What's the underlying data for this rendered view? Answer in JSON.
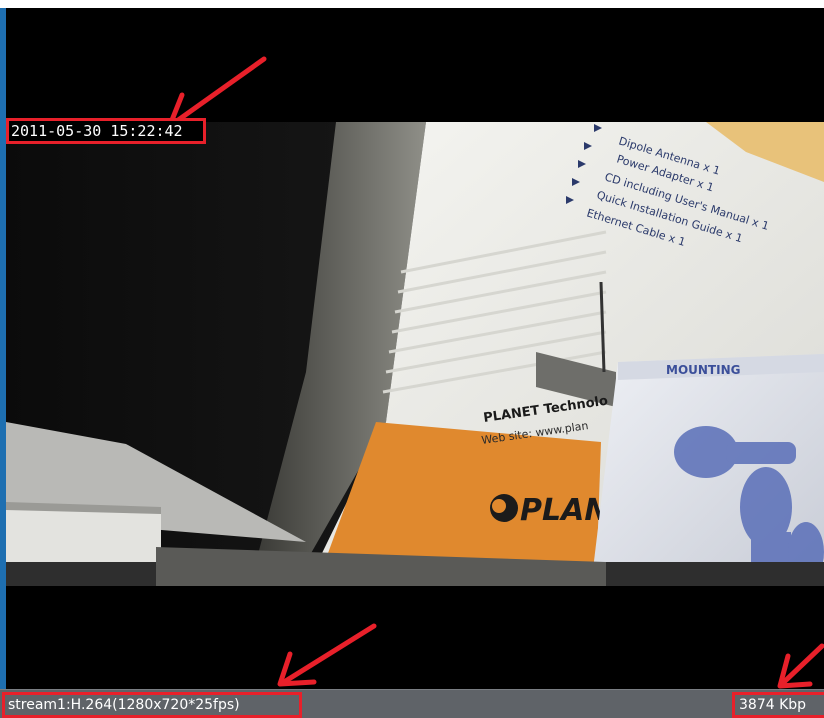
{
  "video": {
    "timestamp": "2011-05-30 15:22:42"
  },
  "status_bar": {
    "stream_info": "stream1:H.264(1280x720*25fps)",
    "bitrate": "3874 Kbp"
  },
  "scene": {
    "box_text_lines": [
      "Dipole Antenna x 1",
      "Power Adapter x 1",
      "CD including User's Manual x 1",
      "Quick Installation Guide x 1",
      "Ethernet Cable x 1"
    ],
    "brand_line": "PLANET Technolo",
    "web_line": "Web site: www.plan",
    "logo_text": "PLAN",
    "mount_box_text": "MOUNTING"
  },
  "colors": {
    "highlight_red": "#e8202a",
    "status_bar": "#5f6368",
    "box_orange": "#e0892e",
    "box_white": "#f2f2ee"
  },
  "icons": {
    "annotation": "red-arrow-icon"
  }
}
